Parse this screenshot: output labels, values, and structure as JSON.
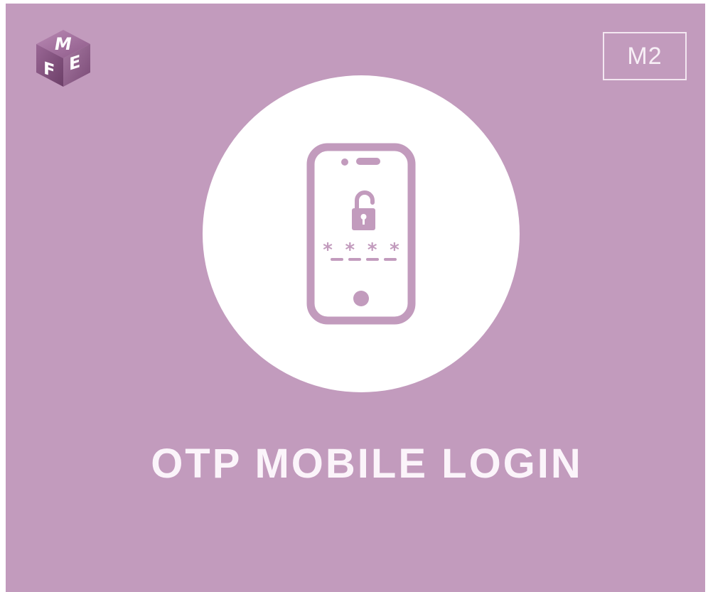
{
  "brand": {
    "logo_letters": [
      "F",
      "M",
      "E"
    ],
    "colors": {
      "background": "#c29bbd",
      "circle": "#ffffff",
      "icon": "#c29bbd",
      "text": "#fbf4fa"
    }
  },
  "badge": {
    "label": "M2"
  },
  "illustration": {
    "icon": "smartphone-lock-icon",
    "pin_mask": "* * * *"
  },
  "title": {
    "text": "OTP MOBILE LOGIN"
  }
}
